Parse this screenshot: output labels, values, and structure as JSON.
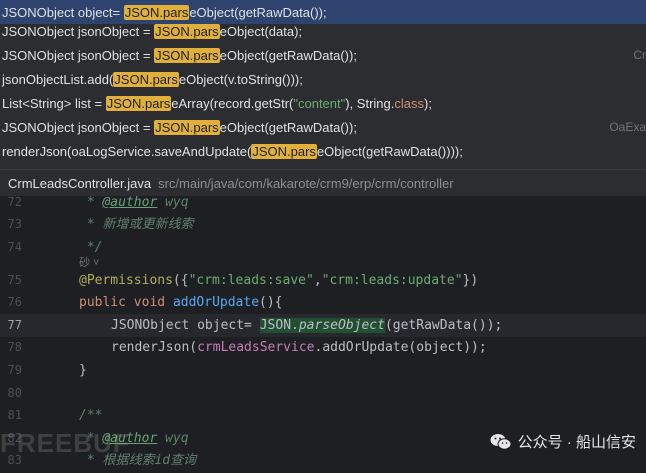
{
  "usages": [
    {
      "parts": [
        "JSONObject object= ",
        "JSON.pars",
        "eObject(getRawData());"
      ],
      "right": "",
      "selected": true
    },
    {
      "parts": [
        "JSONObject jsonObject = ",
        "JSON.pars",
        "eObject(data);"
      ],
      "right": "",
      "selected": false
    },
    {
      "parts": [
        "JSONObject jsonObject = ",
        "JSON.pars",
        "eObject(getRawData());"
      ],
      "right": "Cr",
      "selected": false
    },
    {
      "parts": [
        "jsonObjectList.add(",
        "JSON.pars",
        "eObject(v.toString()));"
      ],
      "right": "",
      "selected": false
    },
    {
      "parts": [
        "List<String> list = ",
        "JSON.pars",
        "eArray(record.getStr(",
        "\"content\"",
        "), String.",
        "class",
        ");"
      ],
      "right": "",
      "selected": false
    },
    {
      "parts": [
        "JSONObject jsonObject = ",
        "JSON.pars",
        "eObject(getRawData());"
      ],
      "right": "OaExa",
      "selected": false
    },
    {
      "parts": [
        "renderJson(oaLogService.saveAndUpdate(",
        "JSON.pars",
        "eObject(getRawData())));"
      ],
      "right": "",
      "selected": false
    }
  ],
  "header": {
    "file_name": "CrmLeadsController.java",
    "file_path": "src/main/java/com/kakarote/crm9/erp/crm/controller"
  },
  "editor": {
    "line_numbers": [
      "72",
      "73",
      "74",
      "",
      "75",
      "76",
      "77",
      "78",
      "79",
      "80",
      "81",
      "82",
      "83"
    ],
    "current_line": "77",
    "inlay_hint": "砂 ˅",
    "lines": {
      "l72": {
        "star": " * ",
        "tag": "@author",
        "rest": " wyq"
      },
      "l73": " * 新增或更新线索",
      "l74": " */",
      "l75": {
        "ann": "@Permissions",
        "open": "({",
        "s1": "\"crm:leads:save\"",
        "comma": ",",
        "s2": "\"crm:leads:update\"",
        "close": "})"
      },
      "l76": {
        "kw1": "public",
        "kw2": "void",
        "fn": "addOrUpdate",
        "rest": "(){"
      },
      "l77": {
        "a": "JSONObject object= ",
        "json": "JSON",
        "dot": ".",
        "m": "parseObject",
        "rest": "(getRawData());"
      },
      "l78": {
        "a": "renderJson(",
        "field": "crmLeadsService",
        "rest": ".addOrUpdate(object));"
      },
      "l80": "}",
      "l82": "/**",
      "l83": {
        "star": " * ",
        "tag": "@author",
        "rest": " wyq"
      },
      "l84": " * 根据线索id查询"
    }
  },
  "watermark": {
    "left": "FREEBUF",
    "right_dot": "公众号 · 船山信安"
  }
}
